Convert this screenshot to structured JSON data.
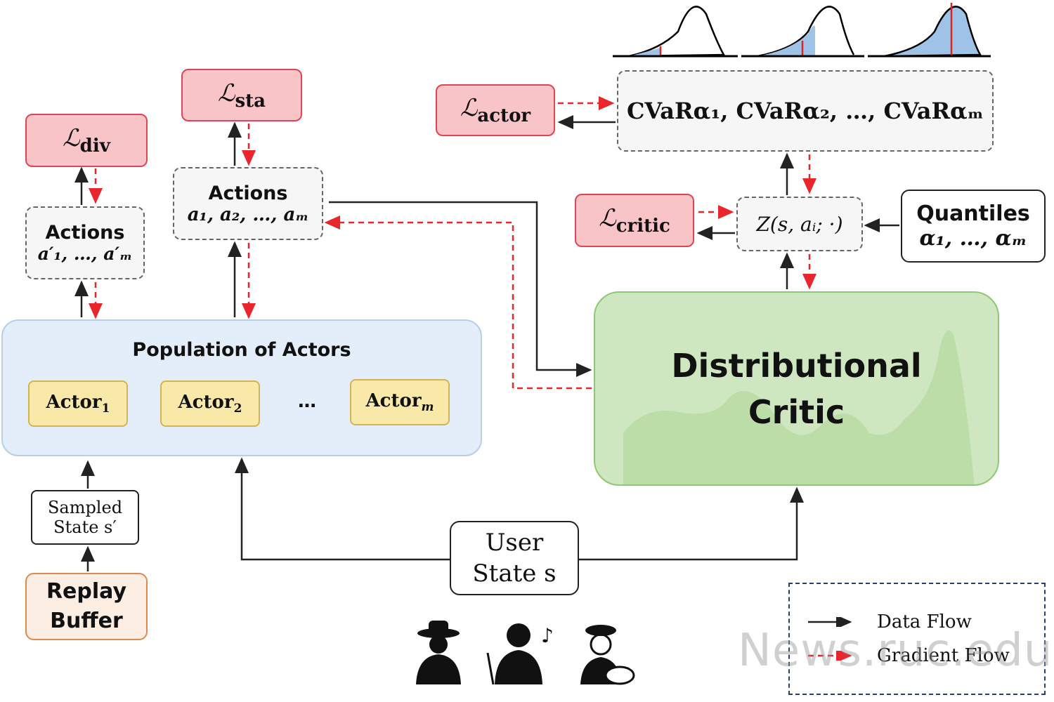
{
  "losses": {
    "div": {
      "symbol": "ℒ",
      "sub": "div"
    },
    "sta": {
      "symbol": "ℒ",
      "sub": "sta"
    },
    "actor": {
      "symbol": "ℒ",
      "sub": "actor"
    },
    "critic": {
      "symbol": "ℒ",
      "sub": "critic"
    }
  },
  "actions_prime": {
    "title": "Actions",
    "math": "a′₁, …, a′ₘ"
  },
  "actions": {
    "title": "Actions",
    "math": "a₁, a₂, …, aₘ"
  },
  "cvar": {
    "text": "CVaRα₁, CVaRα₂, …, CVaRαₘ"
  },
  "z_node": {
    "text": "Z(s, aᵢ; ·)"
  },
  "quantiles": {
    "title": "Quantiles",
    "math": "α₁, …, αₘ"
  },
  "population": {
    "title": "Population of Actors",
    "actors": [
      {
        "label": "Actor",
        "sub": "1"
      },
      {
        "label": "Actor",
        "sub": "2"
      },
      {
        "label": "Actor",
        "sub": "m"
      }
    ],
    "ellipsis": "…"
  },
  "critic": {
    "line1": "Distributional",
    "line2": "Critic"
  },
  "sampled_state": {
    "line1": "Sampled",
    "line2": "State  s′"
  },
  "replay_buffer": {
    "line1": "Replay",
    "line2": "Buffer"
  },
  "user_state": {
    "line1": "User",
    "line2": "State s"
  },
  "legend": {
    "data_flow": "Data Flow",
    "gradient_flow": "Gradient Flow"
  },
  "watermark": "News.ruc.edu.cn",
  "icons": [
    "cowboy-user-icon",
    "musician-user-icon",
    "painter-user-icon"
  ],
  "colors": {
    "loss": "#f9c4c8",
    "population": "#e4eefa",
    "actor": "#f9e9a9",
    "critic": "#cfe7c0",
    "replay": "#fdeee4",
    "gradient": "#e8262c"
  }
}
